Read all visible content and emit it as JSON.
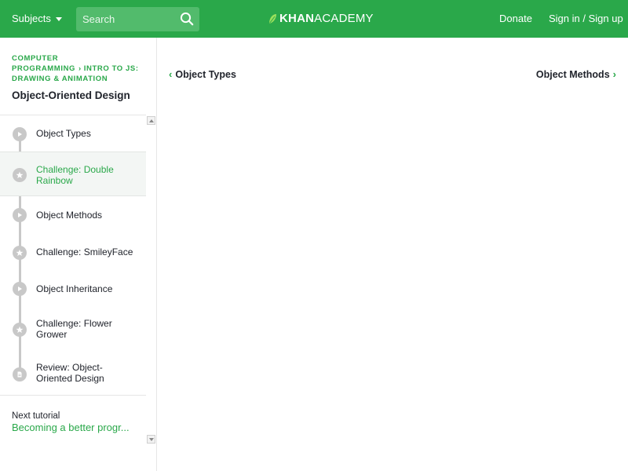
{
  "header": {
    "subjects_label": "Subjects",
    "search_placeholder": "Search",
    "logo_khan": "KHAN",
    "logo_academy": "ACADEMY",
    "donate_label": "Donate",
    "signin_label": "Sign in / Sign up",
    "brand_color": "#2aa84a"
  },
  "sidebar": {
    "breadcrumb_course": "COMPUTER PROGRAMMING",
    "breadcrumb_unit": "INTRO TO JS: DRAWING & ANIMATION",
    "tutorial_title": "Object-Oriented Design",
    "items": [
      {
        "label": "Object Types",
        "icon": "play-icon",
        "active": false
      },
      {
        "label": "Challenge: Double Rainbow",
        "icon": "star-icon",
        "active": true
      },
      {
        "label": "Object Methods",
        "icon": "play-icon",
        "active": false
      },
      {
        "label": "Challenge: SmileyFace",
        "icon": "star-icon",
        "active": false
      },
      {
        "label": "Object Inheritance",
        "icon": "play-icon",
        "active": false
      },
      {
        "label": "Challenge: Flower Grower",
        "icon": "star-icon",
        "active": false
      },
      {
        "label": "Review: Object-Oriented Design",
        "icon": "document-icon",
        "active": false
      }
    ],
    "next_tutorial_label": "Next tutorial",
    "next_tutorial_title": "Becoming a better progr..."
  },
  "main": {
    "prev_article": "Object Types",
    "next_article": "Object Methods"
  }
}
